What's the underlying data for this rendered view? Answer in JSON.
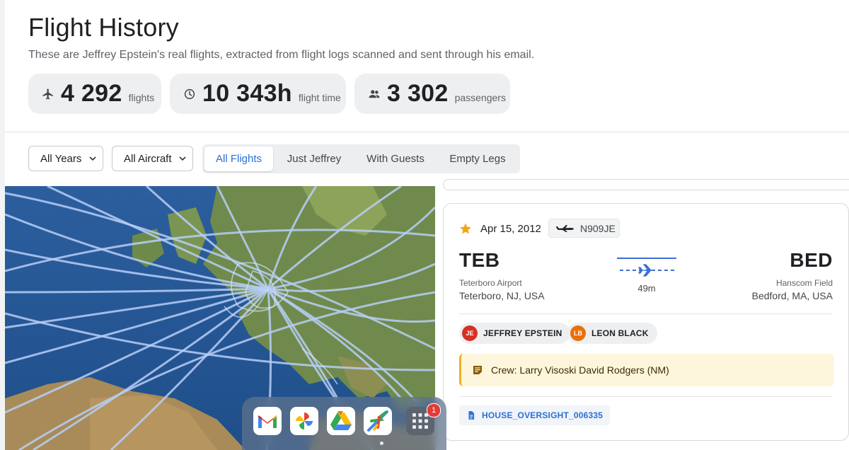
{
  "header": {
    "title": "Flight History",
    "subtitle": "These are Jeffrey Epstein's real flights, extracted from flight logs scanned and sent through his email."
  },
  "stats": [
    {
      "icon": "airplane-icon",
      "value": "4 292",
      "unit": "flights"
    },
    {
      "icon": "clock-icon",
      "value": "10 343h",
      "unit": "flight time"
    },
    {
      "icon": "people-icon",
      "value": "3 302",
      "unit": "passengers"
    }
  ],
  "filters": {
    "year_select": "All Years",
    "aircraft_select": "All Aircraft",
    "segments": [
      "All Flights",
      "Just Jeffrey",
      "With Guests",
      "Empty Legs"
    ],
    "active_segment": "All Flights"
  },
  "flight": {
    "date": "Apr 15, 2012",
    "tail_number": "N909JE",
    "origin": {
      "code": "TEB",
      "airport": "Teterboro Airport",
      "city": "Teterboro, NJ, USA"
    },
    "destination": {
      "code": "BED",
      "airport": "Hanscom Field",
      "city": "Bedford, MA, USA"
    },
    "duration": "49m",
    "passengers": [
      {
        "initials": "JE",
        "name": "JEFFREY EPSTEIN",
        "color": "#d93025"
      },
      {
        "initials": "LB",
        "name": "LEON BLACK",
        "color": "#e8710a"
      }
    ],
    "note": "Crew: Larry Visoski David Rodgers (NM)",
    "document": "HOUSE_OVERSIGHT_006335"
  },
  "dock": {
    "apps": [
      "gmail-icon",
      "photos-icon",
      "drive-icon",
      "flights-app-icon",
      "app-grid-icon"
    ],
    "badge": "1"
  },
  "colors": {
    "accent": "#2b6fd6",
    "star": "#f2a516",
    "note_bg": "#fef6dc",
    "note_border": "#f2b01e"
  }
}
